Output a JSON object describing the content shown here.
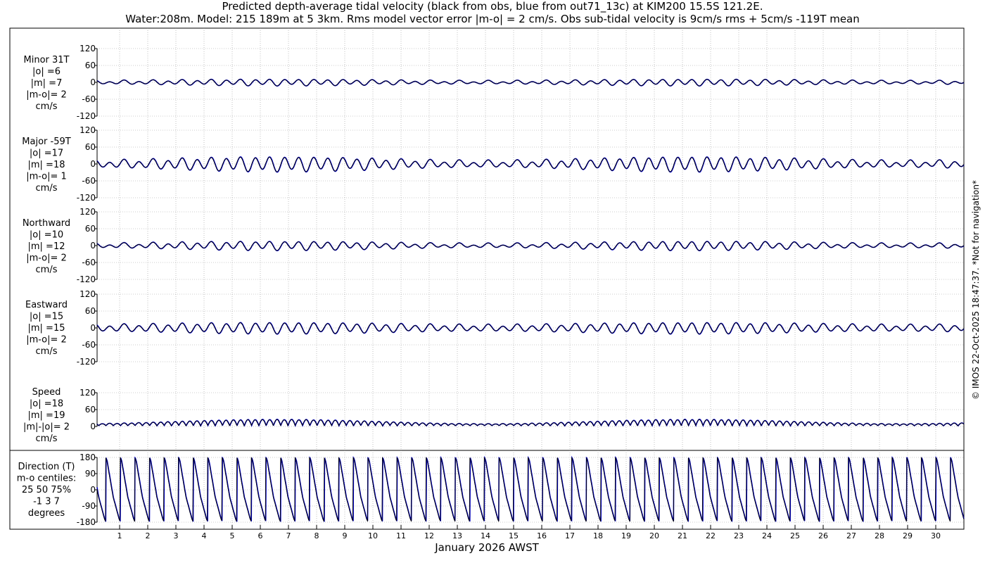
{
  "title_line1": "Predicted depth-average tidal velocity (black from obs, blue from out71_13c) at KIM200 15.5S 121.2E.",
  "title_line2": "Water:208m. Model: 215 189m at 5 3km. Rms model vector error |m-o| = 2 cm/s. Obs sub-tidal velocity is 9cm/s rms + 5cm/s -119T mean",
  "x_label": "January 2026 AWST",
  "copyright": "© IMOS 22-Oct-2025 18:47:37. *Not for navigation*",
  "colors": {
    "obs": "#000000",
    "model": "#0000cc",
    "grid": "#999999"
  },
  "chart_data": {
    "type": "line",
    "x_unit": "day of January 2026",
    "x_range": [
      0.2,
      31.0
    ],
    "x_ticks": [
      1,
      2,
      3,
      4,
      5,
      6,
      7,
      8,
      9,
      10,
      11,
      12,
      13,
      14,
      15,
      16,
      17,
      18,
      19,
      20,
      21,
      22,
      23,
      24,
      25,
      26,
      27,
      28,
      29,
      30
    ],
    "x_tick_labels": [
      "1",
      "2",
      "3",
      "4",
      "5",
      "6",
      "7",
      "8",
      "9",
      "10",
      "11",
      "12",
      "13",
      "14",
      "15",
      "16",
      "17",
      "18",
      "19",
      "20",
      "21",
      "22",
      "23",
      "24",
      "25",
      "26",
      "27",
      "28",
      "29",
      "30"
    ],
    "grid": true,
    "panels": [
      {
        "id": "minor",
        "label_lines": [
          "Minor 31T",
          "|o| =6",
          "|m| =7",
          "|m-o|= 2",
          "cm/s"
        ],
        "ylim": [
          -120,
          120
        ],
        "yticks": [
          -120,
          -60,
          0,
          60,
          120
        ],
        "ytick_labels": [
          "-120",
          "-60",
          "0",
          "60",
          "120"
        ],
        "semidiurnal_amplitude": 10,
        "diurnal_amplitude": 3,
        "modulation_depth": 0.55,
        "series": [
          {
            "color": "model"
          },
          {
            "color": "obs"
          }
        ]
      },
      {
        "id": "major",
        "label_lines": [
          "Major -59T",
          "|o| =17",
          "|m| =18",
          "|m-o|= 1",
          "cm/s"
        ],
        "ylim": [
          -120,
          120
        ],
        "yticks": [
          -120,
          -60,
          0,
          60,
          120
        ],
        "ytick_labels": [
          "-120",
          "-60",
          "0",
          "60",
          "120"
        ],
        "semidiurnal_amplitude": 24,
        "diurnal_amplitude": 5,
        "modulation_depth": 0.6,
        "series": [
          {
            "color": "model"
          },
          {
            "color": "obs"
          }
        ]
      },
      {
        "id": "northward",
        "label_lines": [
          "Northward",
          "|o| =10",
          "|m| =12",
          "|m-o|= 2",
          "cm/s"
        ],
        "ylim": [
          -120,
          120
        ],
        "yticks": [
          -120,
          -60,
          0,
          60,
          120
        ],
        "ytick_labels": [
          "-120",
          "-60",
          "0",
          "60",
          "120"
        ],
        "semidiurnal_amplitude": 14,
        "diurnal_amplitude": 4,
        "modulation_depth": 0.6,
        "series": [
          {
            "color": "model"
          },
          {
            "color": "obs"
          }
        ]
      },
      {
        "id": "eastward",
        "label_lines": [
          "Eastward",
          "|o| =15",
          "|m| =15",
          "|m-o|= 2",
          "cm/s"
        ],
        "ylim": [
          -120,
          120
        ],
        "yticks": [
          -120,
          -60,
          0,
          60,
          120
        ],
        "ytick_labels": [
          "-120",
          "-60",
          "0",
          "60",
          "120"
        ],
        "semidiurnal_amplitude": 18,
        "diurnal_amplitude": 4,
        "modulation_depth": 0.45,
        "series": [
          {
            "color": "model"
          },
          {
            "color": "obs"
          }
        ]
      },
      {
        "id": "speed",
        "label_lines": [
          "Speed",
          "|o| =18",
          "|m| =19",
          "|m|-|o|= 2",
          "cm/s"
        ],
        "ylim": [
          0,
          120
        ],
        "yticks": [
          0,
          60,
          120
        ],
        "ytick_labels": [
          "0",
          "60",
          "120"
        ],
        "semidiurnal_amplitude": 22,
        "diurnal_amplitude": 3,
        "modulation_depth": 0.7,
        "series": [
          {
            "color": "model"
          },
          {
            "color": "obs"
          }
        ]
      },
      {
        "id": "direction",
        "label_lines": [
          "Direction (T)",
          "m-o centiles:",
          "25  50  75%",
          "-1  3  7",
          "degrees"
        ],
        "ylim": [
          -180,
          180
        ],
        "yticks": [
          -180,
          -90,
          0,
          90,
          180
        ],
        "ytick_labels": [
          "-180",
          "-90",
          "0",
          "90",
          "180"
        ],
        "series": [
          {
            "color": "model"
          },
          {
            "color": "obs"
          }
        ]
      }
    ],
    "tidal_periods_days": {
      "semidiurnal": 0.5175,
      "diurnal": 0.9973,
      "spring_neap": 14.77
    }
  }
}
